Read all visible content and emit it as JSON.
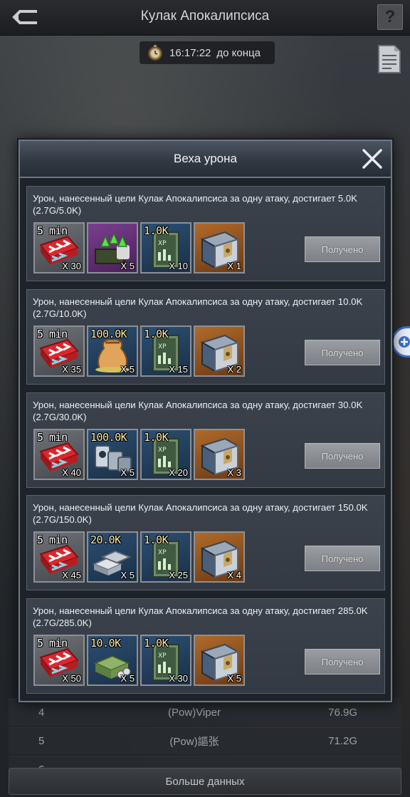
{
  "header": {
    "title": "Кулак Апокалипсиса",
    "help_label": "?",
    "timer": "16:17:22",
    "timer_suffix": "до конца"
  },
  "leaderboard": {
    "rows": [
      {
        "rank": "4",
        "name": "(Pow)Viper",
        "score": "76.9G"
      },
      {
        "rank": "5",
        "name": "(Pow)謳张",
        "score": "71.2G"
      },
      {
        "rank": "6",
        "name": "",
        "score": ""
      }
    ],
    "more_label": "Больше данных"
  },
  "modal": {
    "title": "Веха урона",
    "milestones": [
      {
        "description": "Урон, нанесенный цели Кулак Апокалипсиса за одну атаку, достигает 5.0K",
        "progress": "(2.7G/5.0K)",
        "button": "Получено",
        "items": [
          {
            "icon": "speedup-5min-icon",
            "frame": "gray",
            "tag": "5 min",
            "qty": "X 30"
          },
          {
            "icon": "troop-upgrade-icon",
            "frame": "purple",
            "tag": "",
            "qty": "X 5"
          },
          {
            "icon": "xp-book-icon",
            "frame": "blue",
            "tag": "1.0K",
            "qty": "X 10"
          },
          {
            "icon": "supply-chest-icon",
            "frame": "orange",
            "tag": "",
            "qty": "X 1"
          }
        ]
      },
      {
        "description": "Урон, нанесенный цели Кулак Апокалипсиса за одну атаку, достигает 10.0K",
        "progress": "(2.7G/10.0K)",
        "button": "Получено",
        "items": [
          {
            "icon": "speedup-5min-icon",
            "frame": "gray",
            "tag": "5 min",
            "qty": "X 35"
          },
          {
            "icon": "food-sack-icon",
            "frame": "blue",
            "tag": "100.0K",
            "qty": "X 5"
          },
          {
            "icon": "xp-book-icon",
            "frame": "blue",
            "tag": "1.0K",
            "qty": "X 15"
          },
          {
            "icon": "supply-chest-icon",
            "frame": "orange",
            "tag": "",
            "qty": "X 2"
          }
        ]
      },
      {
        "description": "Урон, нанесенный цели Кулак Апокалипсиса за одну атаку, достигает 30.0K",
        "progress": "(2.7G/30.0K)",
        "button": "Получено",
        "items": [
          {
            "icon": "speedup-5min-icon",
            "frame": "gray",
            "tag": "5 min",
            "qty": "X 40"
          },
          {
            "icon": "oil-barrels-icon",
            "frame": "blue",
            "tag": "100.0K",
            "qty": "X 5"
          },
          {
            "icon": "xp-book-icon",
            "frame": "blue",
            "tag": "1.0K",
            "qty": "X 20"
          },
          {
            "icon": "supply-chest-icon",
            "frame": "orange",
            "tag": "",
            "qty": "X 3"
          }
        ]
      },
      {
        "description": "Урон, нанесенный цели Кулак Апокалипсиса за одну атаку, достигает 150.0K",
        "progress": "(2.7G/150.0K)",
        "button": "Получено",
        "items": [
          {
            "icon": "speedup-5min-icon",
            "frame": "gray",
            "tag": "5 min",
            "qty": "X 45"
          },
          {
            "icon": "steel-ingots-icon",
            "frame": "blue",
            "tag": "20.0K",
            "qty": "X 5"
          },
          {
            "icon": "xp-book-icon",
            "frame": "blue",
            "tag": "1.0K",
            "qty": "X 25"
          },
          {
            "icon": "supply-chest-icon",
            "frame": "orange",
            "tag": "",
            "qty": "X 4"
          }
        ]
      },
      {
        "description": "Урон, нанесенный цели Кулак Апокалипсиса за одну атаку, достигает 285.0K",
        "progress": "(2.7G/285.0K)",
        "button": "Получено",
        "items": [
          {
            "icon": "speedup-5min-icon",
            "frame": "gray",
            "tag": "5 min",
            "qty": "X 50"
          },
          {
            "icon": "cash-stack-icon",
            "frame": "blue",
            "tag": "10.0K",
            "qty": "X 5"
          },
          {
            "icon": "xp-book-icon",
            "frame": "blue",
            "tag": "1.0K",
            "qty": "X 30"
          },
          {
            "icon": "supply-chest-icon",
            "frame": "orange",
            "tag": "",
            "qty": "X 5"
          }
        ]
      }
    ]
  },
  "colors": {
    "modal_border": "#6d7886",
    "card_bg": "#3b424c",
    "claim_button": "#8a8d91",
    "fab_accent": "#3d6fd1"
  }
}
